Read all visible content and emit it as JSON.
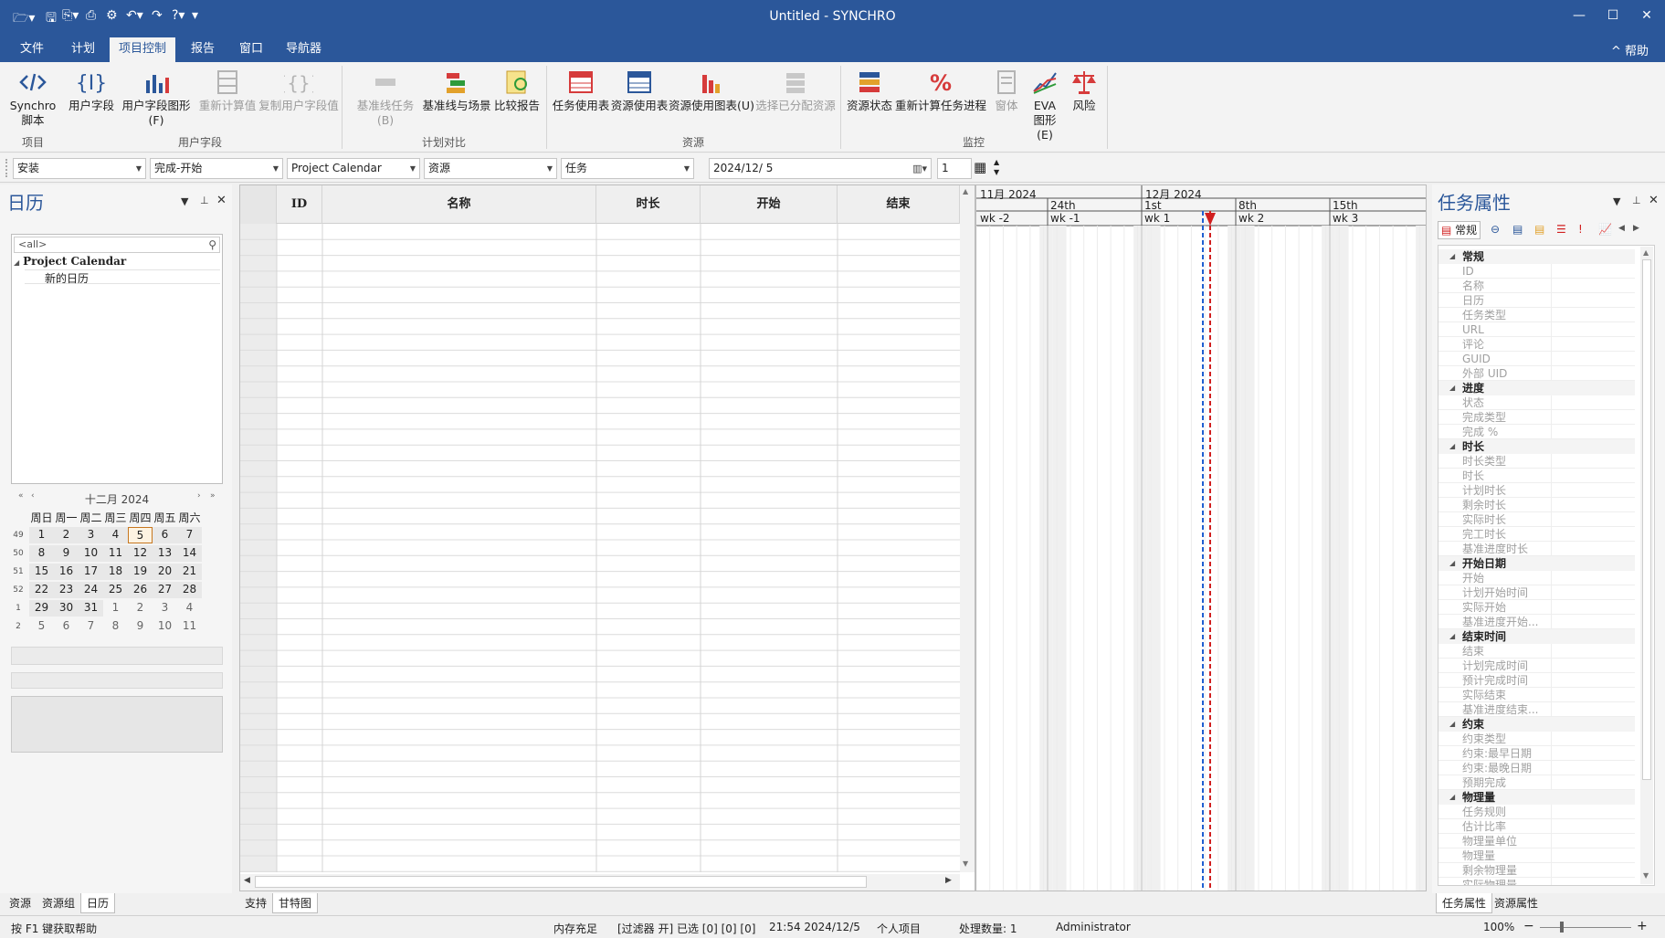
{
  "window": {
    "title": "Untitled - SYNCHRO",
    "minimize": "—",
    "maximize": "☐",
    "close": "✕"
  },
  "menu": {
    "tabs": [
      "文件",
      "计划",
      "项目控制",
      "报告",
      "窗口",
      "导航器"
    ],
    "active": "项目控制",
    "help": "^ 帮助"
  },
  "ribbon": {
    "buttons": [
      {
        "label": "Synchro\n脚本",
        "icon": "code-icon",
        "enabled": true
      },
      {
        "label": "用户字段",
        "icon": "braces-icon",
        "enabled": true
      },
      {
        "label": "用户字段图形(F)",
        "icon": "bar-chart-icon",
        "enabled": true
      },
      {
        "label": "重新计算值",
        "icon": "table-calc-icon",
        "enabled": false
      },
      {
        "label": "复制用户字段值",
        "icon": "copy-braces-icon",
        "enabled": false
      },
      {
        "label": "基准线任务(B)",
        "icon": "baseline-task-icon",
        "enabled": false
      },
      {
        "label": "基准线与场景",
        "icon": "baseline-scenario-icon",
        "enabled": true
      },
      {
        "label": "比较报告",
        "icon": "compare-report-icon",
        "enabled": true
      },
      {
        "label": "任务使用表",
        "icon": "task-usage-icon",
        "enabled": true
      },
      {
        "label": "资源使用表",
        "icon": "resource-usage-icon",
        "enabled": true
      },
      {
        "label": "资源使用图表(U)",
        "icon": "resource-chart-icon",
        "enabled": true
      },
      {
        "label": "选择已分配资源",
        "icon": "select-resource-icon",
        "enabled": false
      },
      {
        "label": "资源状态",
        "icon": "resource-status-icon",
        "enabled": true
      },
      {
        "label": "重新计算任务进程",
        "icon": "percent-icon",
        "enabled": true
      },
      {
        "label": "窗体",
        "icon": "form-icon",
        "enabled": false
      },
      {
        "label": "EVA\n图形(E)",
        "icon": "eva-chart-icon",
        "enabled": true
      },
      {
        "label": "风险",
        "icon": "scales-icon",
        "enabled": true
      }
    ],
    "groups": [
      "项目",
      "用户字段",
      "计划对比",
      "资源",
      "监控"
    ]
  },
  "toolbar": {
    "combo1": "安装",
    "combo2": "完成-开始",
    "combo3": "Project Calendar",
    "combo4": "资源",
    "combo5": "任务",
    "date": "2024/12/ 5",
    "spin": "1"
  },
  "calendar_panel": {
    "title": "日历",
    "filter": "<all>",
    "tree_root": "Project Calendar",
    "tree_child": "新的日历",
    "month_title": "十二月 2024",
    "weekdays": [
      "周日",
      "周一",
      "周二",
      "周三",
      "周四",
      "周五",
      "周六"
    ],
    "weeks": [
      {
        "wk": "49",
        "days": [
          "1",
          "2",
          "3",
          "4",
          "5",
          "6",
          "7"
        ]
      },
      {
        "wk": "50",
        "days": [
          "8",
          "9",
          "10",
          "11",
          "12",
          "13",
          "14"
        ]
      },
      {
        "wk": "51",
        "days": [
          "15",
          "16",
          "17",
          "18",
          "19",
          "20",
          "21"
        ]
      },
      {
        "wk": "52",
        "days": [
          "22",
          "23",
          "24",
          "25",
          "26",
          "27",
          "28"
        ]
      },
      {
        "wk": "1",
        "days": [
          "29",
          "30",
          "31",
          "1",
          "2",
          "3",
          "4"
        ]
      },
      {
        "wk": "2",
        "days": [
          "5",
          "6",
          "7",
          "8",
          "9",
          "10",
          "11"
        ]
      }
    ],
    "selected_day": "5",
    "tabs": [
      "资源",
      "资源组",
      "日历"
    ],
    "active_tab": "日历"
  },
  "grid": {
    "columns": [
      "ID",
      "名称",
      "时长",
      "开始",
      "结束"
    ],
    "tabs": [
      "支持",
      "甘特图"
    ],
    "active_tab": "甘特图"
  },
  "gantt": {
    "months": [
      "11月 2024",
      "12月 2024"
    ],
    "days": [
      "24th",
      "1st",
      "8th",
      "15th"
    ],
    "weeks": [
      "wk -2",
      "wk -1",
      "wk 1",
      "wk 2",
      "wk 3"
    ]
  },
  "properties": {
    "title": "任务属性",
    "tab_general": "常规",
    "categories": [
      {
        "name": "常规",
        "items": [
          "ID",
          "名称",
          "日历",
          "任务类型",
          "URL",
          "评论",
          "GUID",
          "外部 UID"
        ]
      },
      {
        "name": "进度",
        "items": [
          "状态",
          "完成类型",
          "完成 %"
        ]
      },
      {
        "name": "时长",
        "items": [
          "时长类型",
          "时长",
          "计划时长",
          "剩余时长",
          "实际时长",
          "完工时长",
          "基准进度时长"
        ]
      },
      {
        "name": "开始日期",
        "items": [
          "开始",
          "计划开始时间",
          "实际开始",
          "基准进度开始..."
        ]
      },
      {
        "name": "结束时间",
        "items": [
          "结束",
          "计划完成时间",
          "预计完成时间",
          "实际结束",
          "基准进度结束..."
        ]
      },
      {
        "name": "约束",
        "items": [
          "约束类型",
          "约束:最早日期",
          "约束:最晚日期",
          "预期完成"
        ]
      },
      {
        "name": "物理量",
        "items": [
          "任务规则",
          "估计比率",
          "物理量单位",
          "物理量",
          "剩余物理量",
          "实际物理量"
        ]
      }
    ],
    "tabs": [
      "任务属性",
      "资源属性"
    ],
    "active_tab": "任务属性"
  },
  "status": {
    "help": "按 F1 键获取帮助",
    "memory": "内存充足",
    "filter": "[过滤器 开] 已选 [0] [0] [0]",
    "datetime": "21:54 2024/12/5",
    "project": "个人项目",
    "process": "处理数量: 1",
    "user": "Administrator",
    "zoom": "100%"
  },
  "colors": {
    "accent": "#2b579a",
    "today_marker": "#d11f1f",
    "status_line": "#1f5fd1"
  }
}
